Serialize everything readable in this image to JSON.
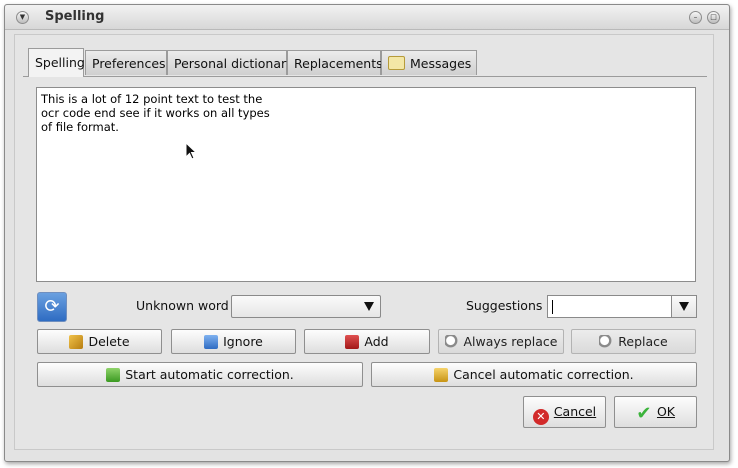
{
  "window": {
    "title": "Spelling"
  },
  "tabs": [
    {
      "label": "Spelling"
    },
    {
      "label": "Preferences"
    },
    {
      "label": "Personal dictionary"
    },
    {
      "label": "Replacements"
    },
    {
      "label": "Messages"
    }
  ],
  "text_area": {
    "content": "This is a lot of 12 point text to test the\nocr code end see if it works on all types\nof file format."
  },
  "unknown_word": {
    "label": "Unknown word :",
    "value": ""
  },
  "suggestions": {
    "label": "Suggestions :",
    "value": ""
  },
  "buttons": {
    "delete": "Delete",
    "ignore": "Ignore",
    "add": "Add",
    "always_replace": "Always replace",
    "replace": "Replace",
    "start_auto": "Start automatic correction.",
    "cancel_auto": "Cancel automatic correction.",
    "cancel": "Cancel",
    "ok": "OK"
  },
  "colors": {
    "window_bg": "#e3e3e3",
    "refresh_blue": "#2f6cc2",
    "cancel_red": "#d22a2a",
    "ok_green": "#3bb33b"
  }
}
